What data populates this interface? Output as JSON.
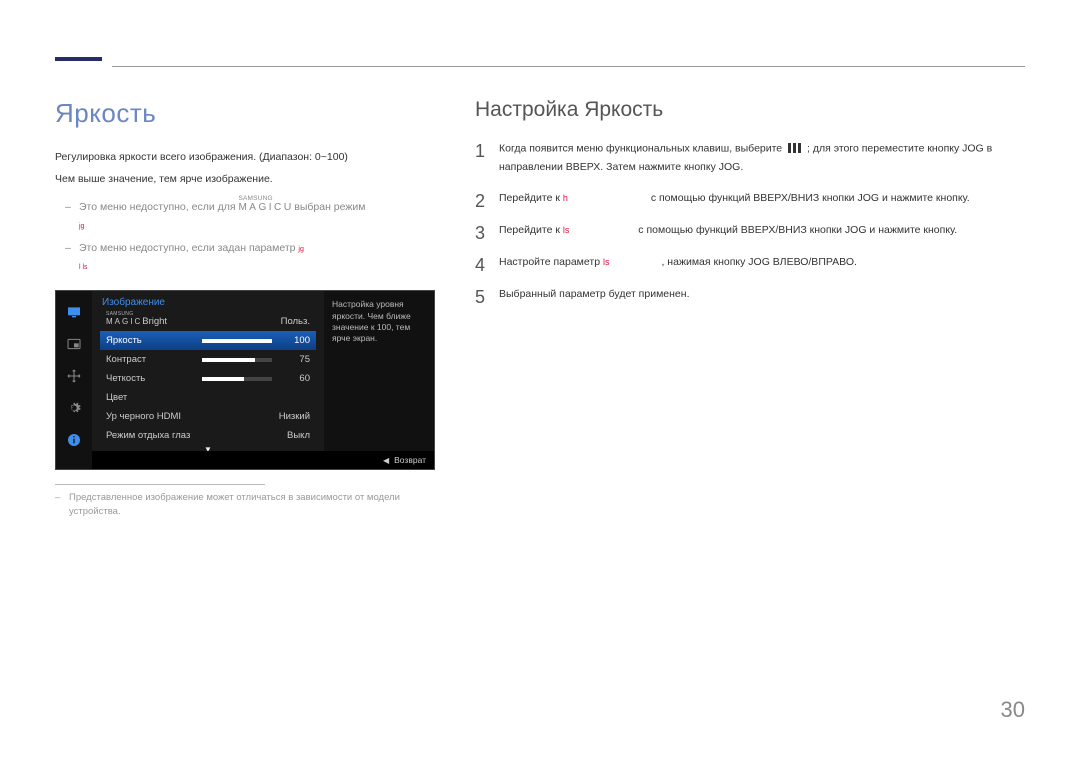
{
  "title_left": "Яркость",
  "title_right": "Настройка Яркость",
  "intro1": "Регулировка яркости всего изображения. (Диапазон: 0~100)",
  "intro2": "Чем выше значение, тем ярче изображение.",
  "note1_pre": "Это меню недоступно, если для ",
  "note1_magic_brand": "SAMSUNG",
  "note1_magic_word": "MAGIC",
  "note1_u": "U",
  "note1_post": " выбран режим",
  "note1_line2": "jg",
  "note2_pre": "Это меню недоступно, если задан параметр ",
  "note2_red": "jg",
  "note2_line2": "l ls",
  "osd": {
    "heading": "Изображение",
    "tooltip": "Настройка уровня яркости. Чем ближе значение к 100, тем ярче экран.",
    "back": "Возврат",
    "rows": [
      {
        "label": "Bright",
        "brandtop": "SAMSUNG",
        "brandbot": "MAGIC",
        "value": "Польз.",
        "bar": null,
        "selected": false,
        "special": "magic"
      },
      {
        "label": "Яркость",
        "value": "100",
        "bar": 100,
        "selected": true
      },
      {
        "label": "Контраст",
        "value": "75",
        "bar": 75,
        "selected": false
      },
      {
        "label": "Четкость",
        "value": "60",
        "bar": 60,
        "selected": false
      },
      {
        "label": "Цвет",
        "value": "",
        "bar": null,
        "selected": false
      },
      {
        "label": "Ур черного HDMI",
        "value": "Низкий",
        "bar": null,
        "selected": false
      },
      {
        "label": "Режим отдыха глаз",
        "value": "Выкл",
        "bar": null,
        "selected": false
      }
    ]
  },
  "smallnote": "Представленное изображение может отличаться в зависимости от модели устройства.",
  "steps": {
    "s1a": "Когда появится меню функциональных клавиш, выберите ",
    "s1b": " ; для этого переместите кнопку JOG в направлении ВВЕРХ. Затем нажмите кнопку JOG.",
    "s2a": "Перейдите к ",
    "s2red": "h",
    "s2b": " с помощью функций ВВЕРХ/ВНИЗ кнопки JOG и нажмите кнопку.",
    "s3a": "Перейдите к ",
    "s3red": "ls",
    "s3b": " с помощью функций ВВЕРХ/ВНИЗ кнопки JOG и нажмите кнопку.",
    "s4a": "Настройте параметр ",
    "s4red": "ls",
    "s4b": ", нажимая кнопку JOG ВЛЕВО/ВПРАВО.",
    "s5": "Выбранный параметр будет применен."
  },
  "pagenum": "30"
}
